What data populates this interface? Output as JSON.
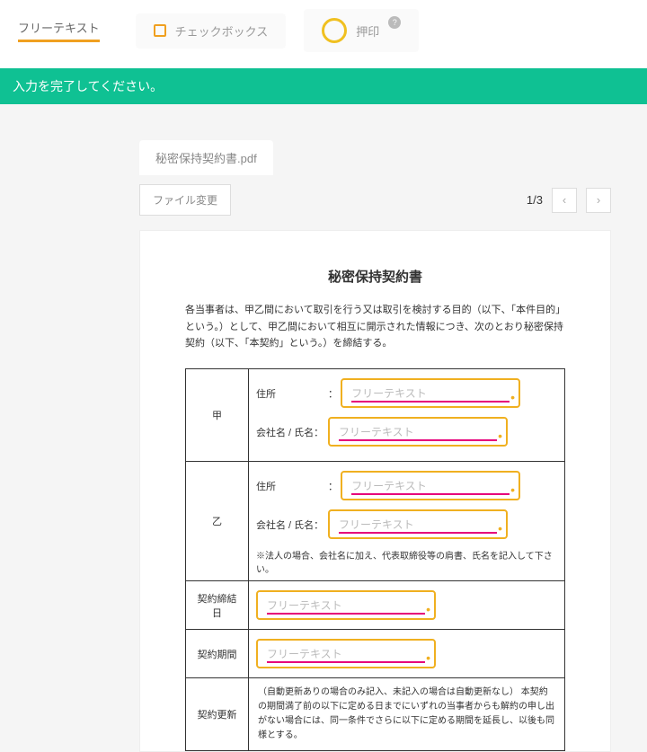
{
  "toolbar": {
    "freetext": "フリーテキスト",
    "checkbox": "チェックボックス",
    "seal": "押印"
  },
  "banner": "入力を完了してください。",
  "file": {
    "tab": "秘密保持契約書.pdf",
    "change": "ファイル変更",
    "page": "1/3"
  },
  "doc": {
    "title": "秘密保持契約書",
    "intro": "各当事者は、甲乙間において取引を行う又は取引を検討する目的（以下、「本件目的」という。）として、甲乙間において相互に開示された情報につき、次のとおり秘密保持契約（以下、「本契約」という。）を締結する。",
    "kou": "甲",
    "otsu": "乙",
    "addr": "住所",
    "name": "会社名 / 氏名：",
    "colon": "：",
    "note": "※法人の場合、会社名に加え、代表取締役等の肩書、氏名を記入して下さい。",
    "date": "契約締結日",
    "period": "契約期間",
    "renew": "契約更新",
    "renew_text": "（自動更新ありの場合のみ記入、未記入の場合は自動更新なし）\n本契約の期間満了前の以下に定める日までにいずれの当事者からも解約の申し出がない場合には、同一条件でさらに以下に定める期間を延長し、以後も同様とする。",
    "placeholder": "フリーテキスト"
  }
}
